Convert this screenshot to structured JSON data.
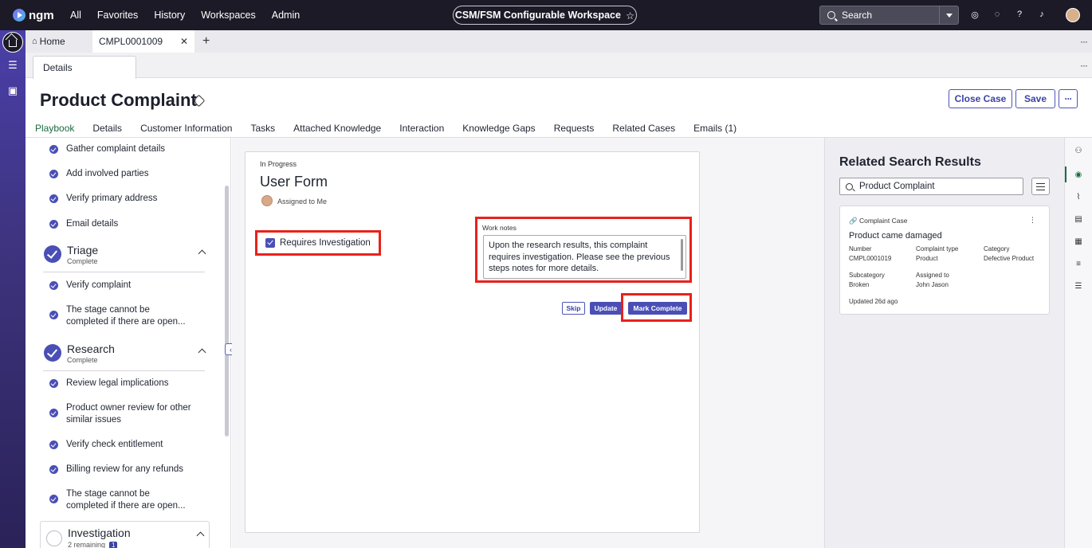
{
  "topbar": {
    "logo": "ngm",
    "nav": [
      "All",
      "Favorites",
      "History",
      "Workspaces",
      "Admin"
    ],
    "workspace": "CSM/FSM Configurable Workspace",
    "search_placeholder": "Search"
  },
  "tabs": {
    "home": "Home",
    "case": "CMPL0001009"
  },
  "subtab": "Details",
  "header": {
    "title": "Product Complaint",
    "close_case": "Close Case",
    "save": "Save",
    "more": "···"
  },
  "main_tabs": [
    "Playbook",
    "Details",
    "Customer Information",
    "Tasks",
    "Attached Knowledge",
    "Interaction",
    "Knowledge Gaps",
    "Requests",
    "Related Cases",
    "Emails (1)"
  ],
  "playbook": {
    "steps_top": [
      "Gather complaint details",
      "Add involved parties",
      "Verify primary address",
      "Email details"
    ],
    "triage": {
      "name": "Triage",
      "status": "Complete"
    },
    "triage_steps": [
      "Verify complaint",
      "The stage cannot be completed if there are open..."
    ],
    "research": {
      "name": "Research",
      "status": "Complete"
    },
    "research_steps": [
      "Review legal implications",
      "Product owner review for other similar issues",
      "Verify check entitlement",
      "Billing review for any refunds",
      "The stage cannot be completed if there are open..."
    ],
    "investigation": {
      "name": "Investigation",
      "status": "2 remaining",
      "badge": "1"
    }
  },
  "form": {
    "status": "In Progress",
    "title": "User Form",
    "assigned": "Assigned to Me",
    "checkbox_label": "Requires Investigation",
    "checkbox_checked": true,
    "work_notes_label": "Work notes",
    "work_notes": "Upon the research results, this complaint requires investigation. Please see the previous steps notes for more details.",
    "skip": "Skip",
    "update": "Update",
    "mark_complete": "Mark Complete"
  },
  "related": {
    "title": "Related Search Results",
    "query": "Product Complaint",
    "card": {
      "type": "Complaint Case",
      "name": "Product came damaged",
      "number_label": "Number",
      "number": "CMPL0001019",
      "ctype_label": "Complaint type",
      "ctype": "Product",
      "category_label": "Category",
      "category": "Defective Product",
      "subcategory_label": "Subcategory",
      "subcategory": "Broken",
      "assigned_label": "Assigned to",
      "assigned": "John Jason",
      "updated": "Updated 26d ago"
    }
  },
  "colors": {
    "accent": "#4a4fb6",
    "highlight": "#e8221a",
    "active_tab": "#1c6b40",
    "topbar": "#1b1a26"
  }
}
